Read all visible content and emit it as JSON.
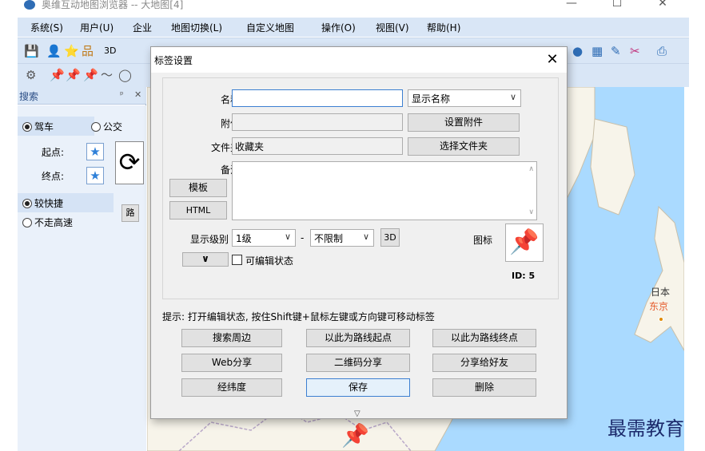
{
  "window": {
    "title": "奥维互动地图浏览器 -- 大地图[4]",
    "minimize": "—",
    "maximize": "☐",
    "close": "✕"
  },
  "menu": [
    "系统(S)",
    "用户(U)",
    "企业",
    "地图切换(L)",
    "自定义地图",
    "操作(O)",
    "视图(V)",
    "帮助(H)"
  ],
  "toolbar1": [
    "💾",
    "👤",
    "⭐",
    "品",
    "3D",
    "●",
    "▦",
    "✎",
    "✂",
    "⎙"
  ],
  "toolbar2": [
    "⚙",
    "📌",
    "📌",
    "📌",
    "〜",
    "◯"
  ],
  "side_panel": {
    "title": "搜索",
    "pin": "ᵖ",
    "close": "✕",
    "mode_drive": "驾车",
    "mode_bus": "公交",
    "start_label": "起点:",
    "end_label": "终点:",
    "route_fast": "较快捷",
    "route_nohighway": "不走高速",
    "swap": "⟳",
    "star": "★",
    "side_btn": "路"
  },
  "map": {
    "label_japan": "日本",
    "label_tokyo": "东京",
    "colors": {
      "sea": "#aadaff",
      "land": "#f7f4ea",
      "border": "#b9a8c9"
    }
  },
  "dialog": {
    "title": "标签设置",
    "close": "✕",
    "name_label": "名称",
    "name_value": "",
    "display_mode": "显示名称",
    "attach_label": "附件",
    "attach_value": "",
    "set_attach": "设置附件",
    "folder_label": "文件夹",
    "folder_value": "收藏夹",
    "choose_folder": "选择文件夹",
    "note_label": "备注",
    "note_value": "",
    "template_btn": "模板",
    "html_btn": "HTML",
    "level_label": "显示级别",
    "level_from": "1级",
    "level_dash": "-",
    "level_to": "不限制",
    "btn_3d": "3D",
    "icon_label": "图标",
    "icon_glyph": "📌",
    "id_text": "ID: 5",
    "more_caret": "∨",
    "editable_label": "可编辑状态",
    "tip": "提示: 打开编辑状态, 按住Shift键+鼠标左键或方向键可移动标签",
    "buttons": [
      "搜索周边",
      "以此为路线起点",
      "以此为路线终点",
      "Web分享",
      "二维码分享",
      "分享给好友",
      "经纬度",
      "保存",
      "删除"
    ],
    "expander": "▽"
  },
  "watermark": "最需教育"
}
